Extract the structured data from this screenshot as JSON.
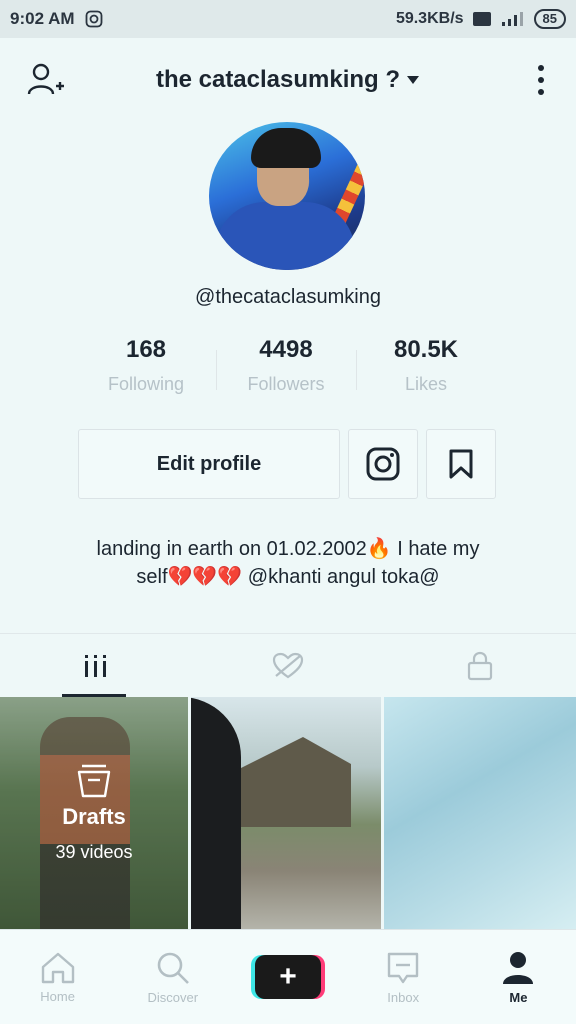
{
  "status_bar": {
    "time": "9:02 AM",
    "speed": "59.3KB/s",
    "battery": "85"
  },
  "header": {
    "title": "the cataclasumking ?"
  },
  "profile": {
    "username": "@thecataclasumking"
  },
  "stats": [
    {
      "value": "168",
      "label": "Following"
    },
    {
      "value": "4498",
      "label": "Followers"
    },
    {
      "value": "80.5K",
      "label": "Likes"
    }
  ],
  "actions": {
    "edit_label": "Edit profile"
  },
  "bio": {
    "line1": "landing in earth on 01.02.2002🔥 I hate my",
    "line2": "self💔💔💔 @khanti angul toka@"
  },
  "drafts": {
    "title": "Drafts",
    "count": "39 videos"
  },
  "nav": {
    "home": "Home",
    "discover": "Discover",
    "create": "+",
    "inbox": "Inbox",
    "me": "Me"
  },
  "colors": {
    "create_left": "#3ee6e6",
    "create_right": "#ff3c78",
    "text": "#1c2630",
    "muted": "#b6c2c8"
  }
}
